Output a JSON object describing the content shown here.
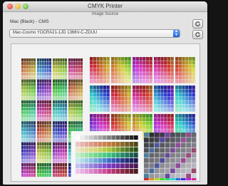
{
  "window": {
    "title": "CMYK Printer",
    "subtitle": "Image Source"
  },
  "controls": {
    "profile_label": "Mac (Black) - CMS",
    "profile_value": "Mac-Cosmo YOCRA21-1JD 1366V-C-ZDUU"
  },
  "icons": {
    "close": "close-icon",
    "minimize": "minimize-icon",
    "zoom": "zoom-icon",
    "popup_arrows": "chevron-updown-icon",
    "refresh_top": "refresh-icon",
    "refresh_bottom": "refresh-icon"
  },
  "colors": {
    "window_bg": "#e3e3e3",
    "accent": "#2a6fe0",
    "canvas_bg": "#f2f2f2"
  }
}
